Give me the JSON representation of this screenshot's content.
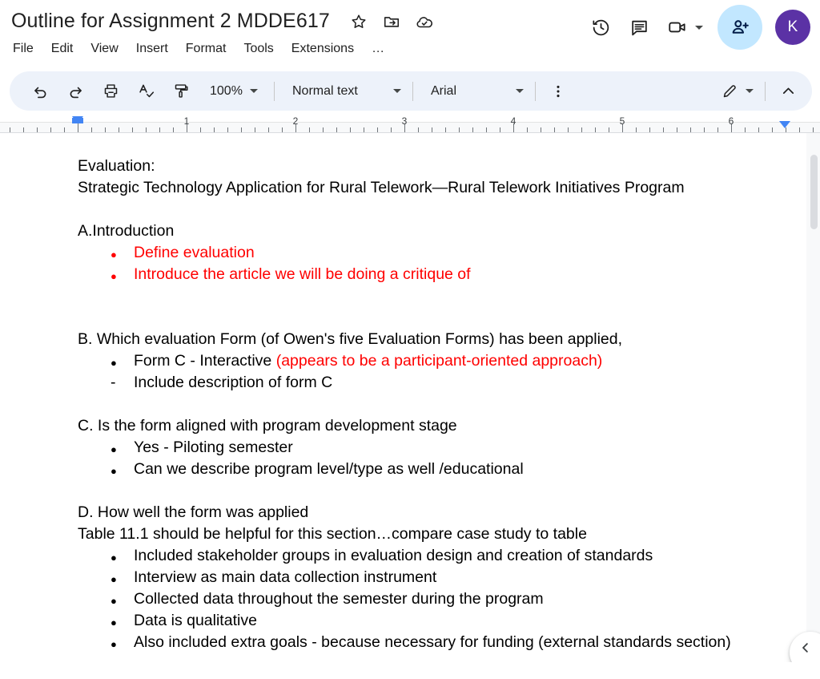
{
  "header": {
    "doc_title": "Outline for Assignment 2 MDDE617",
    "title_icons": [
      {
        "name": "star-icon",
        "label": "Star"
      },
      {
        "name": "move-to-folder-icon",
        "label": "Move"
      },
      {
        "name": "cloud-saved-icon",
        "label": "Saved to Drive"
      }
    ],
    "menus": [
      "File",
      "Edit",
      "View",
      "Insert",
      "Format",
      "Tools",
      "Extensions",
      "…"
    ],
    "right_actions": [
      {
        "name": "version-history-icon",
        "label": "Version history"
      },
      {
        "name": "comment-icon",
        "label": "Comments"
      },
      {
        "name": "meet-camera-icon",
        "label": "Join call"
      }
    ],
    "share_label": "Share",
    "avatar_initial": "K",
    "avatar_color": "#5b32a5",
    "share_color": "#c2e7ff"
  },
  "toolbar": {
    "undo_label": "Undo",
    "redo_label": "Redo",
    "print_label": "Print",
    "spelling_label": "Spelling and grammar check",
    "paint_format_label": "Paint format",
    "zoom_value": "100%",
    "style_value": "Normal text",
    "font_value": "Arial",
    "more_label": "More",
    "mode_label": "Editing mode",
    "collapse_label": "Hide the menus"
  },
  "ruler": {
    "numbers": [
      "1",
      "2",
      "3",
      "4",
      "5",
      "6"
    ],
    "left_indent_label": "Left indent",
    "right_indent_label": "Right indent",
    "marker_color": "#4285f4"
  },
  "document": {
    "blocks": [
      {
        "type": "p",
        "runs": [
          {
            "text": "Evaluation:",
            "color": "black"
          }
        ]
      },
      {
        "type": "p",
        "runs": [
          {
            "text": "Strategic Technology Application for Rural Telework—Rural Telework Initiatives Program",
            "color": "black"
          }
        ]
      },
      {
        "type": "spacer"
      },
      {
        "type": "p",
        "runs": [
          {
            "text": "A.Introduction",
            "color": "black"
          }
        ]
      },
      {
        "type": "bullet",
        "marker": "●",
        "marker_color": "red",
        "runs": [
          {
            "text": "Define evaluation",
            "color": "red"
          }
        ]
      },
      {
        "type": "bullet",
        "marker": "●",
        "marker_color": "red",
        "runs": [
          {
            "text": "Introduce the article we will be doing a critique of",
            "color": "red"
          }
        ]
      },
      {
        "type": "spacer-lg"
      },
      {
        "type": "p",
        "runs": [
          {
            "text": "B. Which evaluation Form (of Owen's five Evaluation Forms) has been applied,",
            "color": "black"
          }
        ]
      },
      {
        "type": "bullet",
        "marker": "●",
        "marker_color": "black",
        "runs": [
          {
            "text": "Form C - Interactive ",
            "color": "black"
          },
          {
            "text": "(appears to be a participant-oriented approach)",
            "color": "red"
          }
        ]
      },
      {
        "type": "bullet",
        "marker": "-",
        "marker_color": "black",
        "runs": [
          {
            "text": "Include description of form C",
            "color": "black"
          }
        ]
      },
      {
        "type": "spacer"
      },
      {
        "type": "p",
        "runs": [
          {
            "text": "C. Is the form aligned with program development stage",
            "color": "black"
          }
        ]
      },
      {
        "type": "bullet",
        "marker": "●",
        "marker_color": "black",
        "runs": [
          {
            "text": "Yes - Piloting semester",
            "color": "black"
          }
        ]
      },
      {
        "type": "bullet",
        "marker": "●",
        "marker_color": "black",
        "runs": [
          {
            "text": "Can we describe program level/type as well /educational",
            "color": "black"
          }
        ]
      },
      {
        "type": "spacer"
      },
      {
        "type": "p",
        "runs": [
          {
            "text": "D. How well the form was applied",
            "color": "black"
          }
        ]
      },
      {
        "type": "p",
        "runs": [
          {
            "text": "Table 11.1 should be helpful for this section…compare case study to table",
            "color": "black"
          }
        ]
      },
      {
        "type": "bullet",
        "marker": "●",
        "marker_color": "black",
        "runs": [
          {
            "text": "Included stakeholder groups in evaluation design and creation of standards",
            "color": "black"
          }
        ]
      },
      {
        "type": "bullet",
        "marker": "●",
        "marker_color": "black",
        "runs": [
          {
            "text": "Interview as main data collection instrument",
            "color": "black"
          }
        ]
      },
      {
        "type": "bullet",
        "marker": "●",
        "marker_color": "black",
        "runs": [
          {
            "text": "Collected data throughout the semester during the program",
            "color": "black"
          }
        ]
      },
      {
        "type": "bullet",
        "marker": "●",
        "marker_color": "black",
        "runs": [
          {
            "text": "Data is qualitative",
            "color": "black"
          }
        ]
      },
      {
        "type": "bullet",
        "marker": "●",
        "marker_color": "black",
        "runs": [
          {
            "text": "Also included extra goals - because necessary for funding (external standards section)",
            "color": "black"
          }
        ]
      }
    ],
    "text_colors": {
      "black": "#000000",
      "red": "#ff0000"
    }
  },
  "scroll": {
    "label": "Vertical scrollbar"
  },
  "fab": {
    "label": "Explore"
  }
}
